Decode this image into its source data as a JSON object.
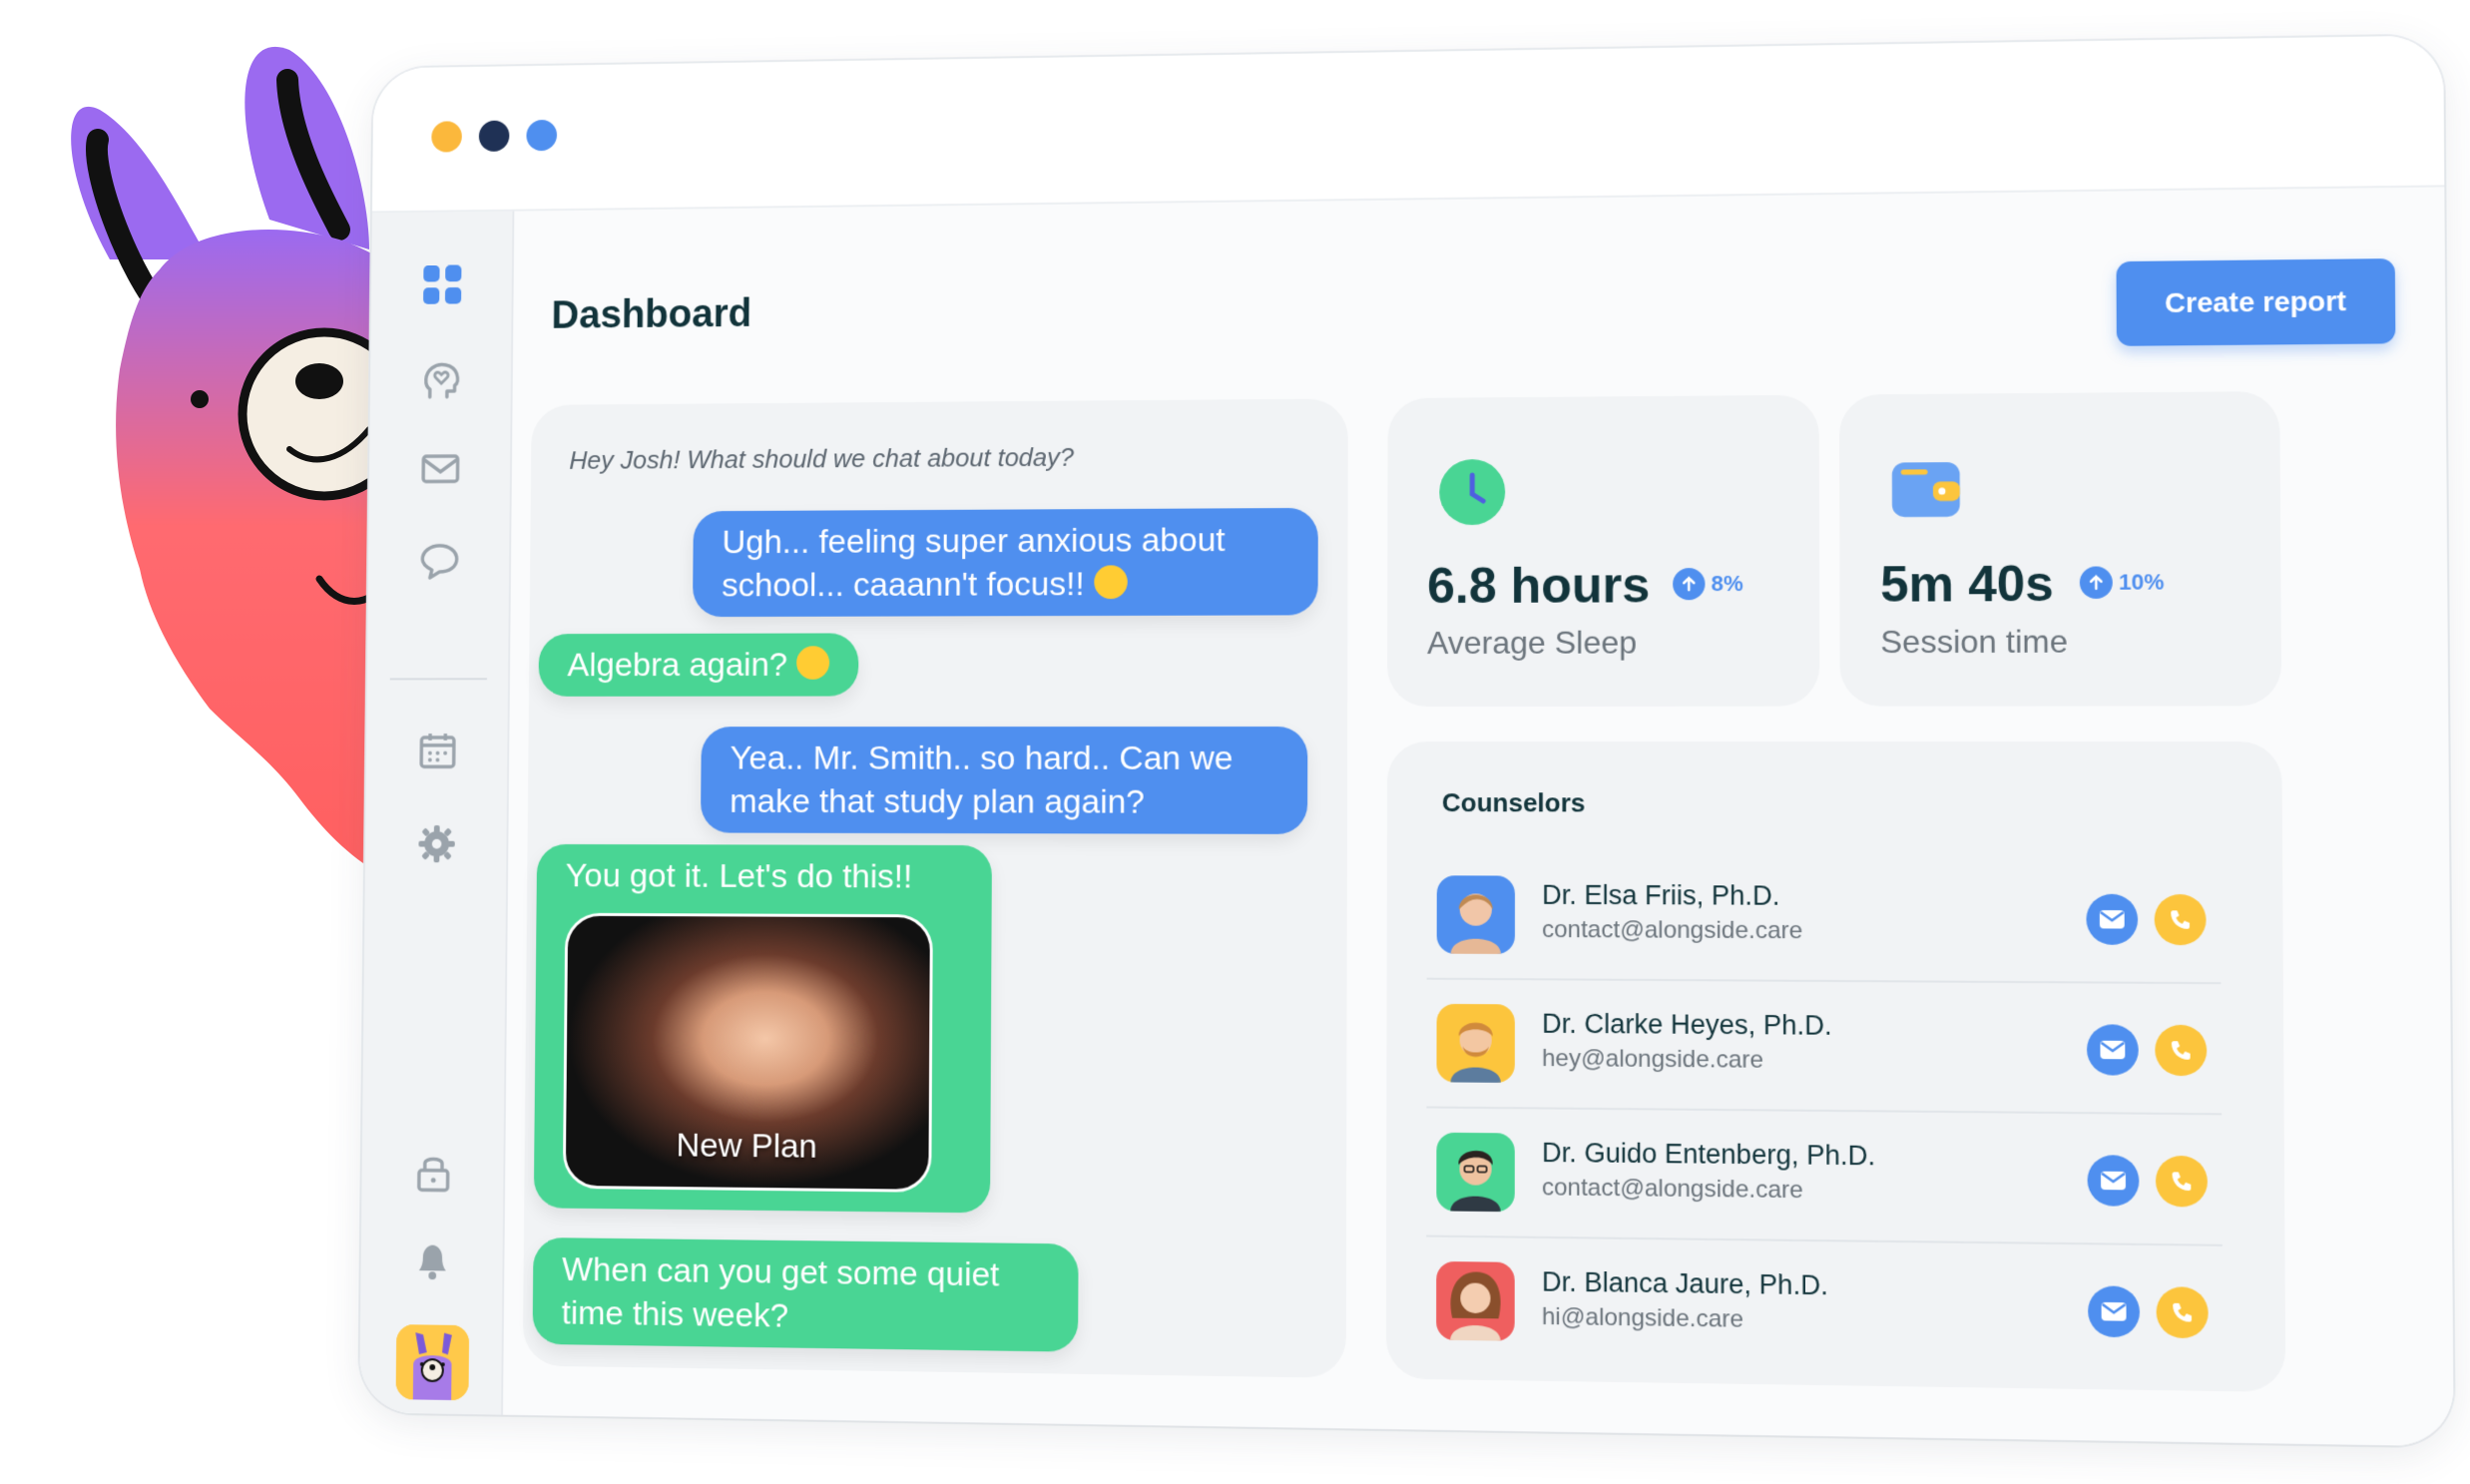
{
  "window": {
    "dots": [
      "#fbb83c",
      "#1f3155",
      "#4f8fef"
    ]
  },
  "sidebar": {
    "icons": [
      "dashboard-icon",
      "mind-heart-icon",
      "mail-icon",
      "chat-icon",
      "calendar-icon",
      "settings-icon",
      "lock-icon",
      "bell-icon"
    ],
    "active": "dashboard-icon"
  },
  "header": {
    "title": "Dashboard",
    "create_label": "Create report"
  },
  "chat": {
    "greeting": "Hey Josh! What should we chat about today?",
    "messages": [
      {
        "text": "Ugh... feeling super anxious about school... caaann't focus!!",
        "from": "user"
      },
      {
        "text": "Algebra again?",
        "from": "bot"
      },
      {
        "text": "Yea.. Mr. Smith.. so hard.. Can we make that study plan again?",
        "from": "user"
      },
      {
        "text": "You got it. Let's do this!!",
        "from": "bot"
      },
      {
        "text": "When can you get some quiet time this week?",
        "from": "bot"
      }
    ],
    "gif_caption": "New Plan"
  },
  "stats": [
    {
      "value": "6.8 hours",
      "change": "8%",
      "label": "Average Sleep",
      "icon": "clock-icon"
    },
    {
      "value": "5m 40s",
      "change": "10%",
      "label": "Session time",
      "icon": "wallet-icon"
    }
  ],
  "counselors": {
    "title": "Counselors",
    "items": [
      {
        "name": "Dr. Elsa Friis, Ph.D.",
        "email": "contact@alongside.care",
        "color": "#4f8fef"
      },
      {
        "name": "Dr. Clarke Heyes, Ph.D.",
        "email": "hey@alongside.care",
        "color": "#fcc53d"
      },
      {
        "name": "Dr. Guido Entenberg, Ph.D.",
        "email": "contact@alongside.care",
        "color": "#49d594"
      },
      {
        "name": "Dr. Blanca Jaure, Ph.D.",
        "email": "hi@alongside.care",
        "color": "#ef5f5f"
      }
    ]
  },
  "colors": {
    "accent": "#4f8fef",
    "green": "#49d594",
    "yellow": "#fcc53d",
    "text": "#12343b"
  }
}
